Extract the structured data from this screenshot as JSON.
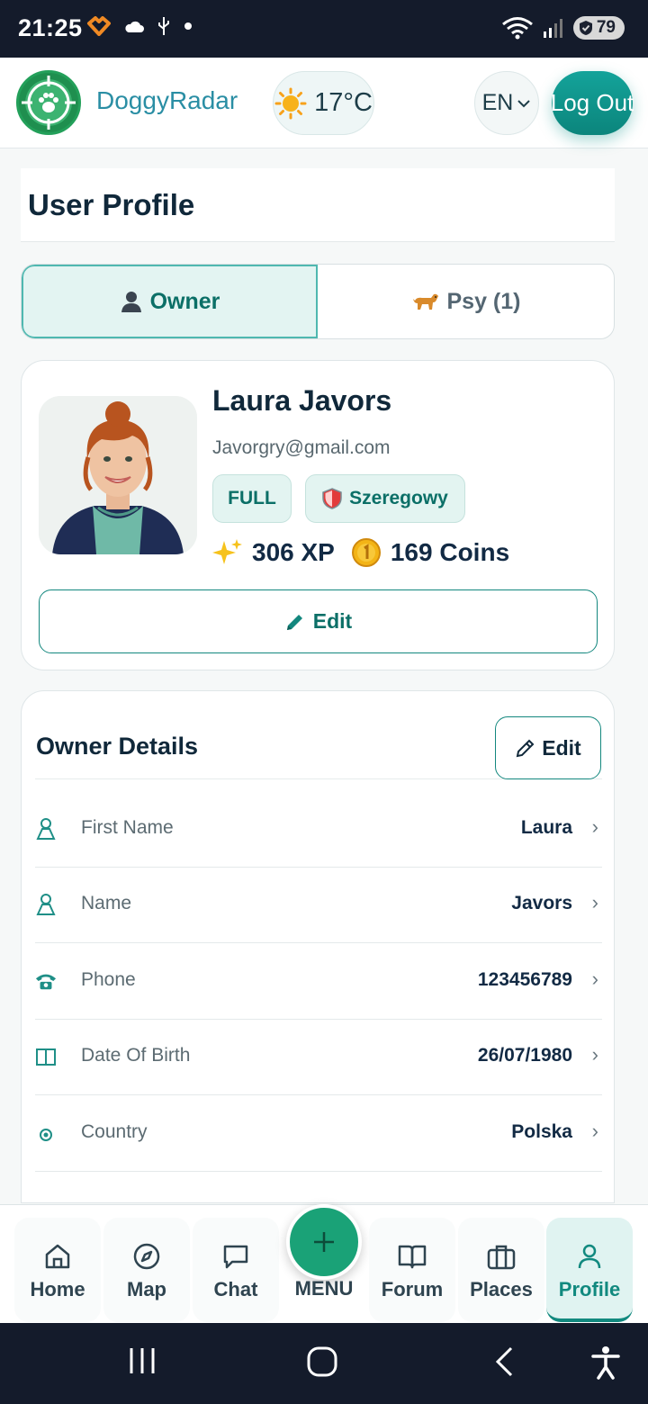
{
  "status_bar": {
    "time": "21:25",
    "battery": "79"
  },
  "header": {
    "brand": "DoggyRadar",
    "weather_temp": "17°C",
    "language": "EN",
    "logout_label": "Log Out"
  },
  "page_title": "User Profile",
  "tabs": [
    {
      "label": "Owner",
      "active": true
    },
    {
      "label": "Psy (1)",
      "active": false
    }
  ],
  "profile": {
    "name": "Laura Javors",
    "email": "Javorgry@gmail.com",
    "badge_plan": "FULL",
    "badge_rank": "Szeregowy",
    "xp": "306 XP",
    "coins": "169 Coins",
    "edit_label": "Edit"
  },
  "owner_details": {
    "title": "Owner Details",
    "edit_label": "Edit",
    "rows": [
      {
        "label": "First Name",
        "value": "Laura",
        "icon": "person-icon"
      },
      {
        "label": "Name",
        "value": "Javors",
        "icon": "person-icon"
      },
      {
        "label": "Phone",
        "value": "123456789",
        "icon": "phone-icon"
      },
      {
        "label": "Date Of Birth",
        "value": "26/07/1980",
        "icon": "calendar-icon"
      },
      {
        "label": "Country",
        "value": "Polska",
        "icon": "location-icon"
      }
    ]
  },
  "bottom_nav": {
    "items": [
      {
        "label": "Home",
        "icon": "home-icon"
      },
      {
        "label": "Map",
        "icon": "compass-icon"
      },
      {
        "label": "Chat",
        "icon": "chat-icon"
      },
      {
        "label": "Forum",
        "icon": "book-icon"
      },
      {
        "label": "Places",
        "icon": "briefcase-icon"
      },
      {
        "label": "Profile",
        "icon": "user-icon",
        "active": true
      }
    ],
    "menu_label": "MENU"
  },
  "colors": {
    "accent": "#13877e",
    "brand_text": "#2a8ea4",
    "fab": "#1aa277"
  }
}
